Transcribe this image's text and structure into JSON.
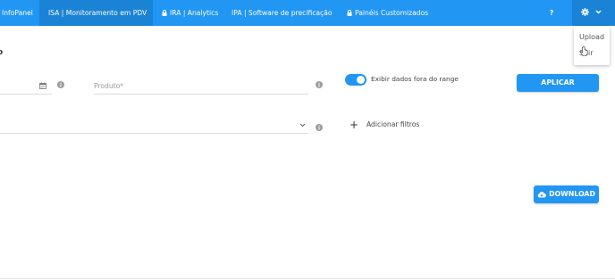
{
  "nav": {
    "brand": "InfoPanel",
    "items": [
      {
        "label": "ISA | Monitoramento em PDV",
        "locked": false,
        "active": true
      },
      {
        "label": "IRA | Analytics",
        "locked": true,
        "active": false
      },
      {
        "label": "IPA | Software de precificação",
        "locked": false,
        "active": false
      },
      {
        "label": "Painéis Customizados",
        "locked": true,
        "active": false
      }
    ],
    "help_label": "?",
    "settings_icon": "gear-icon",
    "settings_caret_icon": "chevron-down-icon"
  },
  "settings_menu": {
    "items": [
      "Upload",
      "Sair"
    ]
  },
  "page": {
    "title_fragment": "o"
  },
  "filters": {
    "date_icon": "calendar-icon",
    "product_placeholder": "Produto*",
    "toggle_label": "Exibir dados fora do range",
    "toggle_on": true,
    "apply_label": "APLICAR",
    "add_filter_label": "Adicionar filtros",
    "select_caret_icon": "chevron-down-icon"
  },
  "actions": {
    "download_label": "DOWNLOAD",
    "download_icon": "cloud-download-icon"
  },
  "colors": {
    "primary": "#2196f3",
    "primary_dark": "#1a83d6",
    "text": "#333333",
    "muted": "#999999"
  }
}
